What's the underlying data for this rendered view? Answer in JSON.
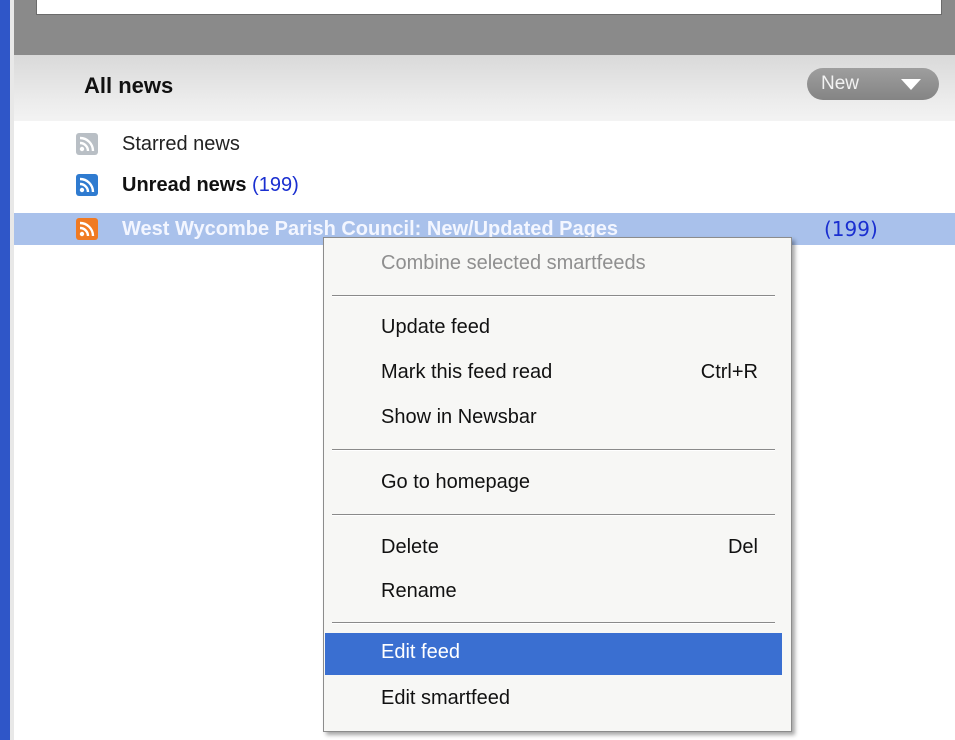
{
  "header": {
    "title": "All news",
    "new_button": "New"
  },
  "feeds": {
    "starred": {
      "label": "Starred news"
    },
    "unread": {
      "label": "Unread news",
      "count": "(199)"
    },
    "west": {
      "label": "West Wycombe Parish Council: New/Updated Pages",
      "count": "(199)"
    }
  },
  "context_menu": {
    "combine": "Combine selected smartfeeds",
    "update_feed": "Update feed",
    "mark_read": "Mark this feed read",
    "mark_read_shortcut": "Ctrl+R",
    "show_newsbar": "Show in Newsbar",
    "go_homepage": "Go to homepage",
    "delete": "Delete",
    "delete_shortcut": "Del",
    "rename": "Rename",
    "edit_feed": "Edit feed",
    "edit_smartfeed": "Edit smartfeed"
  },
  "colors": {
    "selection": "#a9c1eb",
    "menu_highlight": "#3a6fd1",
    "count_blue": "#1a2fd0"
  },
  "icons": {
    "feed_gray": "rss-feed-icon",
    "feed_blue": "rss-feed-icon",
    "feed_orange": "rss-feed-icon",
    "new_caret": "chevron-down-icon"
  }
}
